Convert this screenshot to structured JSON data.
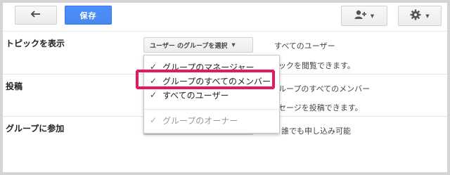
{
  "toolbar": {
    "back_icon": "arrow-left-icon",
    "save_label": "保存",
    "member_icon": "person-add-icon",
    "gear_icon": "gear-icon",
    "caret": "▼"
  },
  "settings": [
    {
      "label": "トピックを表示",
      "dropdown_value": "ユーザー のグループを選択",
      "desc_line1": "すべてのユーザー",
      "desc_line2": "ックを閲覧できます。"
    },
    {
      "label": "投稿",
      "dropdown_value": "",
      "desc_line1": "ループのすべてのメンバー",
      "desc_line2": "セージを投稿できます。"
    },
    {
      "label": "グループに参加",
      "dropdown_value": "",
      "desc_line1": "誰でも申し込み可能"
    }
  ],
  "menu": {
    "items": [
      {
        "label": "グループのマネージャー",
        "checked": true,
        "disabled": false
      },
      {
        "label": "グループのすべてのメンバー",
        "checked": true,
        "disabled": false
      },
      {
        "label": "すべてのユーザー",
        "checked": true,
        "disabled": false
      },
      {
        "label": "グループのオーナー",
        "checked": true,
        "disabled": true
      }
    ],
    "check_glyph": "✓"
  },
  "highlight_color": "#e5195d",
  "accent_color": "#4d90fe"
}
